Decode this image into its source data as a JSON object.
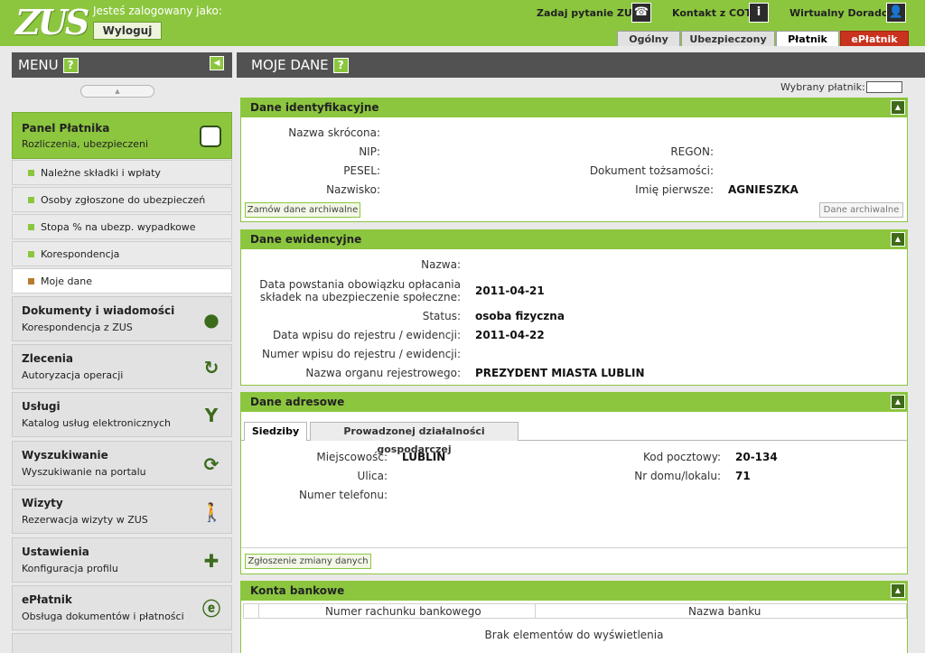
{
  "header": {
    "logo": "ZUS",
    "logged_in_as": "Jesteś zalogowany jako:",
    "logout_label": "Wyloguj",
    "links": [
      {
        "label": "Zadaj pytanie ZUS",
        "icon": "phone-icon"
      },
      {
        "label": "Kontakt z COT",
        "icon": "info-icon"
      },
      {
        "label": "Wirtualny Doradca",
        "icon": "user-icon"
      }
    ],
    "tabs": [
      {
        "label": "Ogólny",
        "active": false
      },
      {
        "label": "Ubezpieczony",
        "active": false
      },
      {
        "label": "Płatnik",
        "active": true
      },
      {
        "label": "ePłatnik",
        "active": false
      }
    ]
  },
  "sidebar": {
    "title": "MENU",
    "help": "?",
    "panel": {
      "title": "Panel Płatnika",
      "subtitle": "Rozliczenia, ubezpieczeni"
    },
    "sub_items": [
      {
        "label": "Należne składki i wpłaty",
        "active": false
      },
      {
        "label": "Osoby zgłoszone do ubezpieczeń",
        "active": false
      },
      {
        "label": "Stopa % na ubezp. wypadkowe",
        "active": false
      },
      {
        "label": "Korespondencja",
        "active": false
      },
      {
        "label": "Moje dane",
        "active": true
      }
    ],
    "items": [
      {
        "title": "Dokumenty i wiadomości",
        "subtitle": "Korespondencja z ZUS",
        "icon": "speech-bubble-icon"
      },
      {
        "title": "Zlecenia",
        "subtitle": "Autoryzacja operacji",
        "icon": "refresh-icon"
      },
      {
        "title": "Usługi",
        "subtitle": "Katalog usług elektronicznych",
        "icon": "network-icon"
      },
      {
        "title": "Wyszukiwanie",
        "subtitle": "Wyszukiwanie na portalu",
        "icon": "sync-icon"
      },
      {
        "title": "Wizyty",
        "subtitle": "Rezerwacja wizyty w ZUS",
        "icon": "walking-person-icon"
      },
      {
        "title": "Ustawienia",
        "subtitle": "Konfiguracja profilu",
        "icon": "puzzle-icon"
      },
      {
        "title": "ePłatnik",
        "subtitle": "Obsługa dokumentów i płatności",
        "icon": "document-e-icon"
      }
    ]
  },
  "main": {
    "title": "MOJE DANE",
    "help": "?",
    "chosen_payer_label": "Wybrany płatnik:",
    "identification": {
      "title": "Dane identyfikacyjne",
      "short_name_label": "Nazwa skrócona:",
      "nip_label": "NIP:",
      "regon_label": "REGON:",
      "pesel_label": "PESEL:",
      "id_document_label": "Dokument tożsamości:",
      "surname_label": "Nazwisko:",
      "first_name_label": "Imię pierwsze:",
      "first_name_value": "AGNIESZKA",
      "order_archive_button": "Zamów dane archiwalne",
      "archive_button": "Dane archiwalne"
    },
    "registration": {
      "title": "Dane ewidencyjne",
      "name_label": "Nazwa:",
      "obligation_label_line1": "Data powstania obowiązku opłacania",
      "obligation_label_line2": "składek na ubezpieczenie społeczne:",
      "obligation_value": "2011-04-21",
      "status_label": "Status:",
      "status_value": "osoba fizyczna",
      "entry_date_label": "Data wpisu do rejestru / ewidencji:",
      "entry_date_value": "2011-04-22",
      "entry_number_label": "Numer wpisu do rejestru / ewidencji:",
      "authority_label": "Nazwa organu rejestrowego:",
      "authority_value": "PREZYDENT MIASTA LUBLIN"
    },
    "address": {
      "title": "Dane adresowe",
      "tabs": [
        {
          "label": "Siedziby",
          "active": true
        },
        {
          "label": "Prowadzonej działalności gospodarczej",
          "active": false
        }
      ],
      "city_label": "Miejscowość:",
      "city_value": "LUBLIN",
      "postal_label": "Kod pocztowy:",
      "postal_value": "20-134",
      "street_label": "Ulica:",
      "house_label": "Nr domu/lokalu:",
      "house_value": "71",
      "phone_label": "Numer telefonu:",
      "change_button": "Zgłoszenie zmiany danych"
    },
    "bank": {
      "title": "Konta bankowe",
      "col_account": "Numer rachunku bankowego",
      "col_bank": "Nazwa banku",
      "empty": "Brak elementów do wyświetlenia"
    }
  }
}
